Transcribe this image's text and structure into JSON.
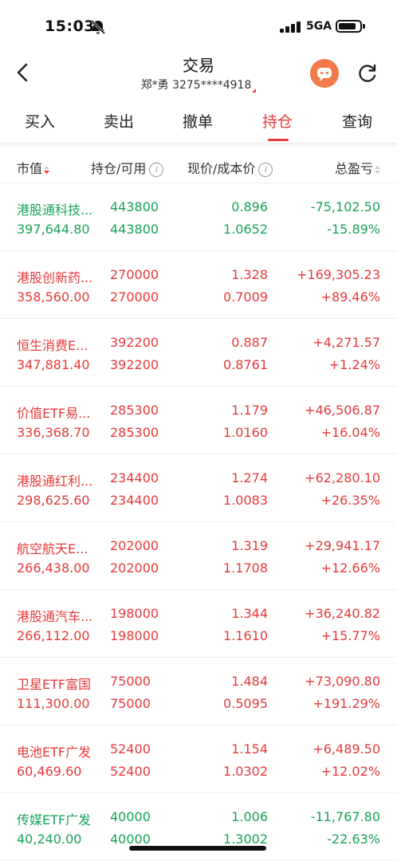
{
  "status_bar": {
    "time": "15:03",
    "network": "5GA",
    "icons": [
      "bell-mute-icon",
      "signal-icon",
      "battery-icon"
    ]
  },
  "header": {
    "title": "交易",
    "account": "郑*勇 3275****4918",
    "icons": [
      "back-icon",
      "avatar-icon",
      "refresh-icon"
    ]
  },
  "tabs": [
    {
      "label": "买入",
      "active": false
    },
    {
      "label": "卖出",
      "active": false
    },
    {
      "label": "撤单",
      "active": false
    },
    {
      "label": "持仓",
      "active": true
    },
    {
      "label": "查询",
      "active": false
    }
  ],
  "columns": {
    "market_value": "市值",
    "position": "持仓/可用",
    "price": "现价/成本价",
    "pnl": "总盈亏"
  },
  "colors": {
    "up": "#e8393a",
    "down": "#17a35a",
    "accent": "#e8393a"
  },
  "holdings": [
    {
      "name": "港股通科技...",
      "market_value": "397,644.80",
      "position": "443800",
      "available": "443800",
      "price": "0.896",
      "cost": "1.0652",
      "pnl": "-75,102.50",
      "pnl_pct": "-15.89%",
      "trend": "down"
    },
    {
      "name": "港股创新药...",
      "market_value": "358,560.00",
      "position": "270000",
      "available": "270000",
      "price": "1.328",
      "cost": "0.7009",
      "pnl": "+169,305.23",
      "pnl_pct": "+89.46%",
      "trend": "up"
    },
    {
      "name": "恒生消费E...",
      "market_value": "347,881.40",
      "position": "392200",
      "available": "392200",
      "price": "0.887",
      "cost": "0.8761",
      "pnl": "+4,271.57",
      "pnl_pct": "+1.24%",
      "trend": "up"
    },
    {
      "name": "价值ETF易...",
      "market_value": "336,368.70",
      "position": "285300",
      "available": "285300",
      "price": "1.179",
      "cost": "1.0160",
      "pnl": "+46,506.87",
      "pnl_pct": "+16.04%",
      "trend": "up"
    },
    {
      "name": "港股通红利...",
      "market_value": "298,625.60",
      "position": "234400",
      "available": "234400",
      "price": "1.274",
      "cost": "1.0083",
      "pnl": "+62,280.10",
      "pnl_pct": "+26.35%",
      "trend": "up"
    },
    {
      "name": "航空航天E...",
      "market_value": "266,438.00",
      "position": "202000",
      "available": "202000",
      "price": "1.319",
      "cost": "1.1708",
      "pnl": "+29,941.17",
      "pnl_pct": "+12.66%",
      "trend": "up"
    },
    {
      "name": "港股通汽车...",
      "market_value": "266,112.00",
      "position": "198000",
      "available": "198000",
      "price": "1.344",
      "cost": "1.1610",
      "pnl": "+36,240.82",
      "pnl_pct": "+15.77%",
      "trend": "up"
    },
    {
      "name": "卫星ETF富国",
      "market_value": "111,300.00",
      "position": "75000",
      "available": "75000",
      "price": "1.484",
      "cost": "0.5095",
      "pnl": "+73,090.80",
      "pnl_pct": "+191.29%",
      "trend": "up"
    },
    {
      "name": "电池ETF广发",
      "market_value": "60,469.60",
      "position": "52400",
      "available": "52400",
      "price": "1.154",
      "cost": "1.0302",
      "pnl": "+6,489.50",
      "pnl_pct": "+12.02%",
      "trend": "up"
    },
    {
      "name": "传媒ETF广发",
      "market_value": "40,240.00",
      "position": "40000",
      "available": "40000",
      "price": "1.006",
      "cost": "1.3002",
      "pnl": "-11,767.80",
      "pnl_pct": "-22.63%",
      "trend": "down"
    }
  ]
}
